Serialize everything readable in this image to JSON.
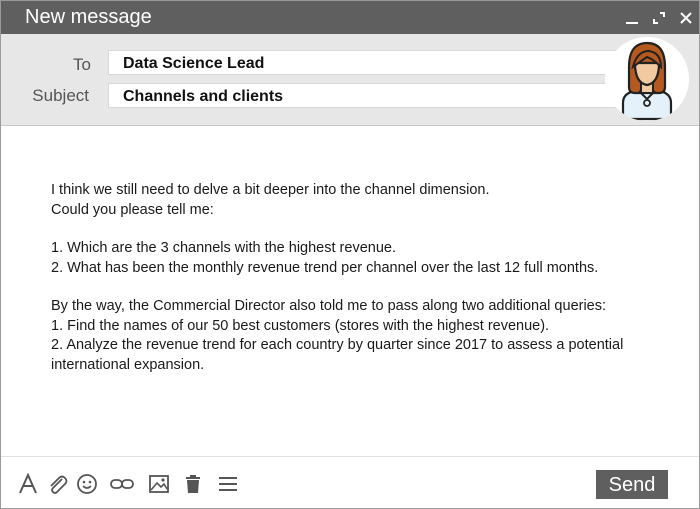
{
  "window": {
    "title": "New message"
  },
  "header": {
    "to_label": "To",
    "to_value": "Data Science Lead",
    "subject_label": "Subject",
    "subject_value": "Channels and clients"
  },
  "message": {
    "lines": [
      "I think we still need  to delve a bit deeper into the channel dimension.",
      "Could you please tell me:",
      "",
      "1. Which are the 3 channels with the highest revenue.",
      "2. What has been the monthly revenue trend per channel over the last 12 full months.",
      "",
      "By the way, the Commercial Director also told me to pass along two additional queries:",
      "1. Find the names of our 50 best customers (stores with the highest revenue).",
      "2. Analyze the revenue trend for each country by quarter since 2017 to assess a potential",
      "international expansion."
    ]
  },
  "toolbar": {
    "send_label": "Send",
    "icons": [
      "text-format-icon",
      "attachment-icon",
      "emoji-icon",
      "link-icon",
      "image-icon",
      "trash-icon",
      "more-options-icon"
    ]
  },
  "colors": {
    "titlebar": "#5f5f5f",
    "header": "#e7e7e7",
    "send_button": "#5f5f5f",
    "avatar_hair": "#b5591f",
    "avatar_skin": "#f3c9a2"
  }
}
